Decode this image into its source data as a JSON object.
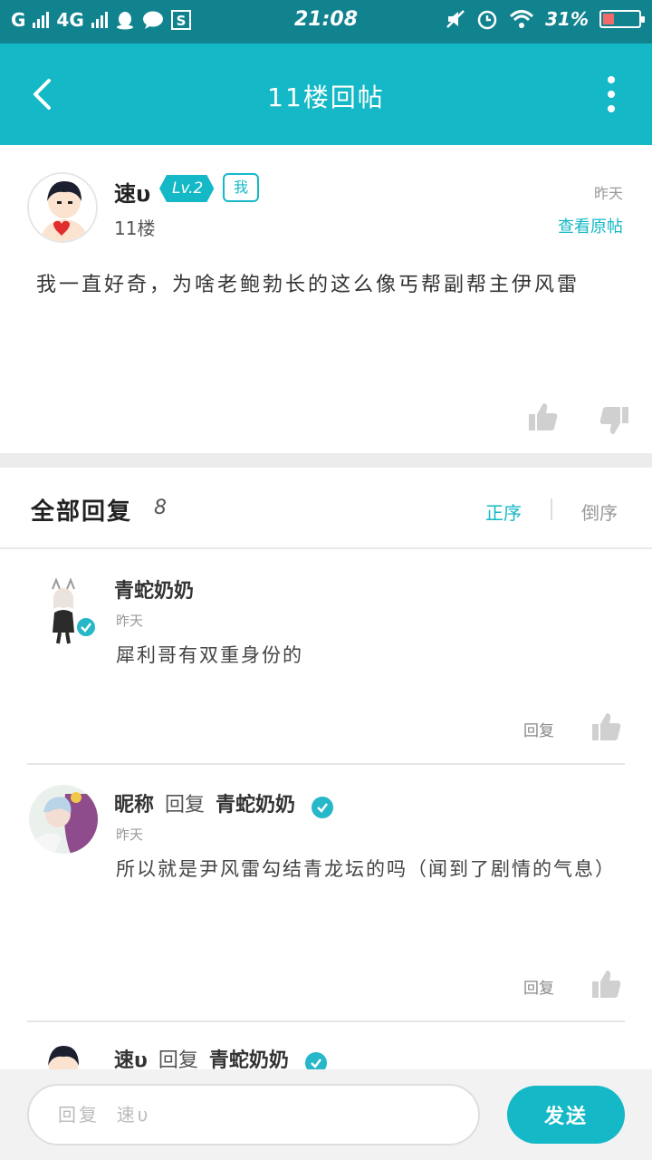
{
  "status_bar": {
    "carrier_1": "G",
    "carrier_2": "4G",
    "time": "21:08",
    "battery_text": "31%",
    "battery_level": 0.31,
    "battery_color": "#f26b6b"
  },
  "header": {
    "title": "11楼回帖",
    "back_icon": "chevron-left-icon",
    "more_icon": "more-vertical-icon",
    "bg_color": "#14b8c6"
  },
  "post": {
    "author": "速υ",
    "level": "Lv.2",
    "me_badge": "我",
    "floor": "11楼",
    "time": "昨天",
    "view_original": "查看原帖",
    "content": "我一直好奇，为啥老鲍勃长的这么像丐帮副帮主伊风雷"
  },
  "replies_header": {
    "title": "全部回复",
    "count": "8",
    "sort_asc": "正序",
    "sort_desc": "倒序"
  },
  "replies": [
    {
      "name": "青蛇奶奶",
      "time": "昨天",
      "text": "犀利哥有双重身份的",
      "reply_label": "回复"
    },
    {
      "name": "昵称",
      "reply_word": "回复",
      "target": "青蛇奶奶",
      "time": "昨天",
      "text": "所以就是尹风雷勾结青龙坛的吗（闻到了剧情的气息）",
      "reply_label": "回复"
    },
    {
      "name": "速υ",
      "reply_word": "回复",
      "target": "青蛇奶奶"
    }
  ],
  "bottom_bar": {
    "input_placeholder": "回复  速υ",
    "send_label": "发送"
  }
}
